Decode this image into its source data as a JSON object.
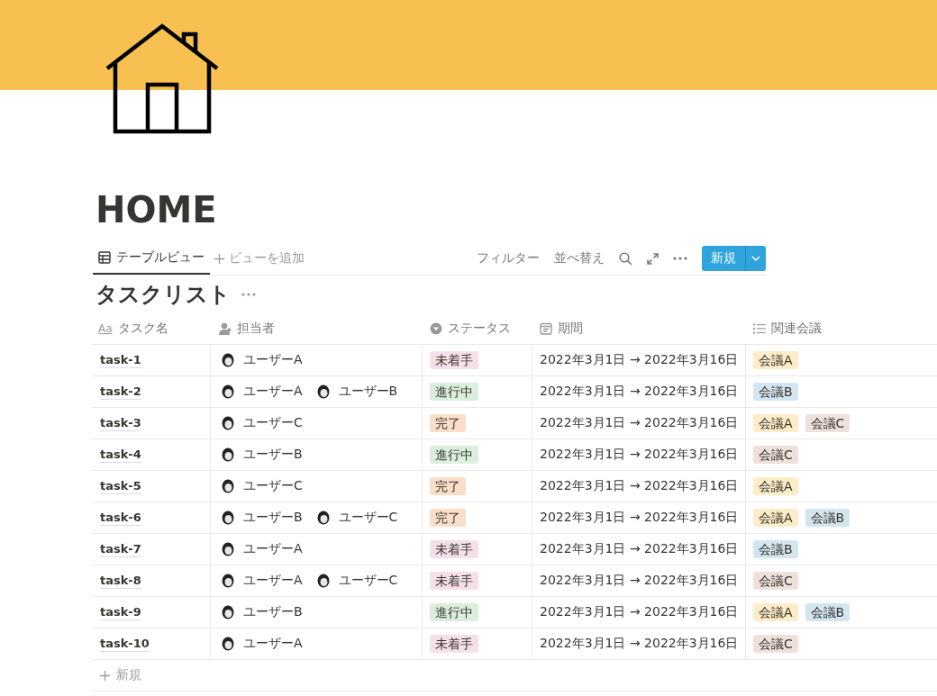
{
  "page": {
    "title": "HOME"
  },
  "views": {
    "tabs": [
      {
        "label": "テーブルビュー",
        "selected": true
      }
    ],
    "add_view": "ビューを追加"
  },
  "toolbar": {
    "filter": "フィルター",
    "sort": "並べ替え",
    "new_button": "新規"
  },
  "database": {
    "title": "タスクリスト",
    "columns": [
      {
        "label": "タスク名",
        "kind": "title",
        "icon_text": "Aa"
      },
      {
        "label": "担当者",
        "kind": "person"
      },
      {
        "label": "ステータス",
        "kind": "select"
      },
      {
        "label": "期間",
        "kind": "date"
      },
      {
        "label": "関連会議",
        "kind": "relation"
      }
    ],
    "rows": [
      {
        "name": "task-1",
        "assignees": [
          "ユーザーA"
        ],
        "status": {
          "label": "未着手",
          "color": "#f5e0e9"
        },
        "period": "2022年3月1日 → 2022年3月16日",
        "meetings": [
          {
            "label": "会議A",
            "color": "#fdecc8"
          }
        ]
      },
      {
        "name": "task-2",
        "assignees": [
          "ユーザーA",
          "ユーザーB"
        ],
        "status": {
          "label": "進行中",
          "color": "#dbeddb"
        },
        "period": "2022年3月1日 → 2022年3月16日",
        "meetings": [
          {
            "label": "会議B",
            "color": "#d3e5ef"
          }
        ]
      },
      {
        "name": "task-3",
        "assignees": [
          "ユーザーC"
        ],
        "status": {
          "label": "完了",
          "color": "#fadec9"
        },
        "period": "2022年3月1日 → 2022年3月16日",
        "meetings": [
          {
            "label": "会議A",
            "color": "#fdecc8"
          },
          {
            "label": "会議C",
            "color": "#eee0da"
          }
        ]
      },
      {
        "name": "task-4",
        "assignees": [
          "ユーザーB"
        ],
        "status": {
          "label": "進行中",
          "color": "#dbeddb"
        },
        "period": "2022年3月1日 → 2022年3月16日",
        "meetings": [
          {
            "label": "会議C",
            "color": "#eee0da"
          }
        ]
      },
      {
        "name": "task-5",
        "assignees": [
          "ユーザーC"
        ],
        "status": {
          "label": "完了",
          "color": "#fadec9"
        },
        "period": "2022年3月1日 → 2022年3月16日",
        "meetings": [
          {
            "label": "会議A",
            "color": "#fdecc8"
          }
        ]
      },
      {
        "name": "task-6",
        "assignees": [
          "ユーザーB",
          "ユーザーC"
        ],
        "status": {
          "label": "完了",
          "color": "#fadec9"
        },
        "period": "2022年3月1日 → 2022年3月16日",
        "meetings": [
          {
            "label": "会議A",
            "color": "#fdecc8"
          },
          {
            "label": "会議B",
            "color": "#d3e5ef"
          }
        ]
      },
      {
        "name": "task-7",
        "assignees": [
          "ユーザーA"
        ],
        "status": {
          "label": "未着手",
          "color": "#f5e0e9"
        },
        "period": "2022年3月1日 → 2022年3月16日",
        "meetings": [
          {
            "label": "会議B",
            "color": "#d3e5ef"
          }
        ]
      },
      {
        "name": "task-8",
        "assignees": [
          "ユーザーA",
          "ユーザーC"
        ],
        "status": {
          "label": "未着手",
          "color": "#f5e0e9"
        },
        "period": "2022年3月1日 → 2022年3月16日",
        "meetings": [
          {
            "label": "会議C",
            "color": "#eee0da"
          }
        ]
      },
      {
        "name": "task-9",
        "assignees": [
          "ユーザーB"
        ],
        "status": {
          "label": "進行中",
          "color": "#dbeddb"
        },
        "period": "2022年3月1日 → 2022年3月16日",
        "meetings": [
          {
            "label": "会議A",
            "color": "#fdecc8"
          },
          {
            "label": "会議B",
            "color": "#d3e5ef"
          }
        ]
      },
      {
        "name": "task-10",
        "assignees": [
          "ユーザーA"
        ],
        "status": {
          "label": "未着手",
          "color": "#f5e0e9"
        },
        "period": "2022年3月1日 → 2022年3月16日",
        "meetings": [
          {
            "label": "会議C",
            "color": "#eee0da"
          }
        ]
      }
    ],
    "add_row": "新規"
  }
}
